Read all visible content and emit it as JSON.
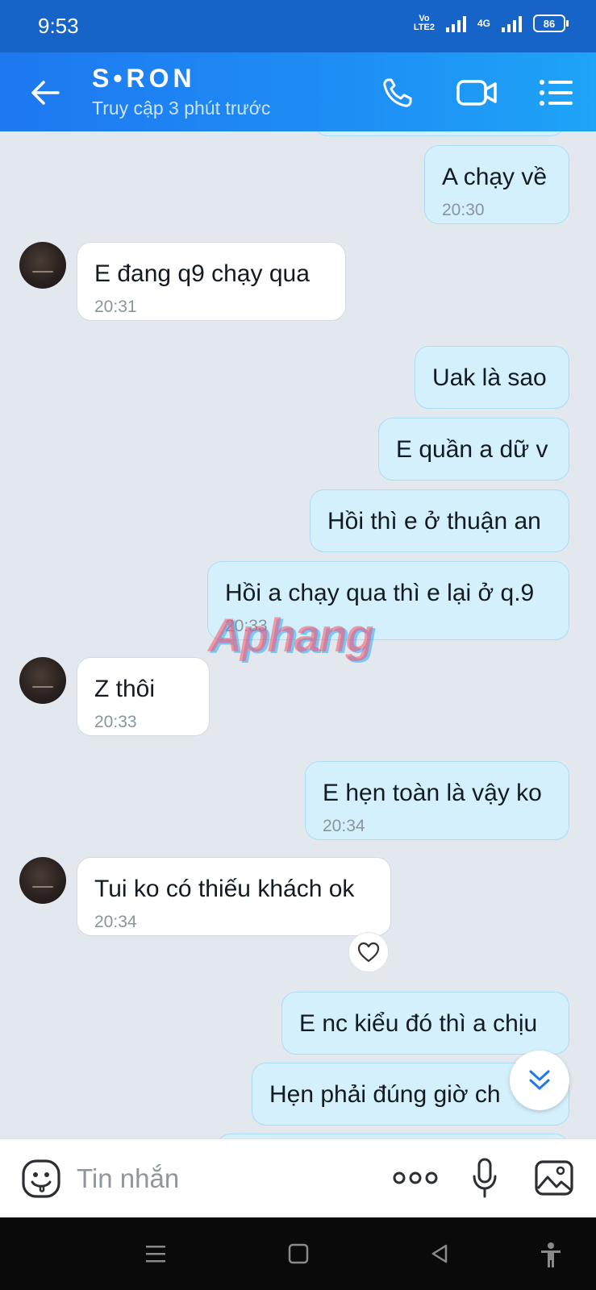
{
  "status_bar": {
    "time": "9:53",
    "volte_top": "Vo",
    "volte_bottom": "LTE2",
    "network": "4G",
    "battery": "86"
  },
  "header": {
    "contact_name": "S•RON",
    "contact_status": "Truy cập 3 phút trước",
    "icons": [
      "back-arrow-icon",
      "phone-icon",
      "video-camera-icon",
      "menu-list-icon"
    ]
  },
  "messages": [
    {
      "direction": "out",
      "text": "A chạy về",
      "time": "20:30"
    },
    {
      "direction": "in",
      "text": "E đang q9 chạy qua",
      "time": "20:31"
    },
    {
      "direction": "out",
      "text": "Uak là sao",
      "time": ""
    },
    {
      "direction": "out",
      "text": "E quần a dữ v",
      "time": ""
    },
    {
      "direction": "out",
      "text": "Hồi thì e ở thuận an",
      "time": ""
    },
    {
      "direction": "out",
      "text": "Hồi a chạy qua thì e lại ở q.9",
      "time": "20:33"
    },
    {
      "direction": "in",
      "text": "Z thôi",
      "time": "20:33"
    },
    {
      "direction": "out",
      "text": "E hẹn toàn là vậy ko",
      "time": "20:34"
    },
    {
      "direction": "in",
      "text": "Tui ko có thiếu khách ok",
      "time": "20:34"
    },
    {
      "direction": "out",
      "text": "E nc kiểu đó thì a chịu",
      "time": ""
    },
    {
      "direction": "out",
      "text": "Hẹn phải đúng giờ ch",
      "time": ""
    }
  ],
  "watermark": "Aphang",
  "input": {
    "placeholder": "Tin nhắn"
  },
  "colors": {
    "header": "#1e8ff5",
    "status_bar": "#1764c8",
    "outgoing_bubble": "#d5f0fd",
    "incoming_bubble": "#ffffff",
    "chat_background": "#e2e8ee"
  }
}
